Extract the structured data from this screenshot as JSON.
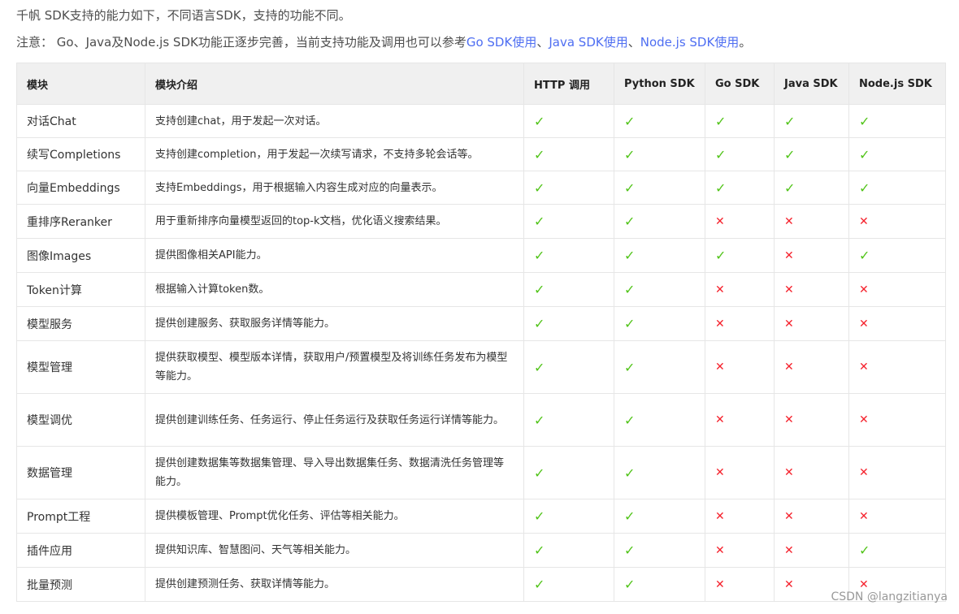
{
  "intro": "千帆 SDK支持的能力如下，不同语言SDK，支持的功能不同。",
  "note": {
    "prefix": "注意：  Go、Java及Node.js SDK功能正逐步完善，当前支持功能及调用也可以参考",
    "link1": "Go SDK使用",
    "sep1": "、",
    "link2": "Java SDK使用",
    "sep2": "、",
    "link3": "Node.js SDK使用",
    "suffix": "。"
  },
  "table": {
    "headers": [
      "模块",
      "模块介绍",
      "HTTP 调用",
      "Python SDK",
      "Go SDK",
      "Java SDK",
      "Node.js SDK"
    ],
    "rows": [
      {
        "name": "对话Chat",
        "desc": "支持创建chat，用于发起一次对话。",
        "support": [
          "✓",
          "✓",
          "✓",
          "✓",
          "✓"
        ]
      },
      {
        "name": "续写Completions",
        "desc": "支持创建completion，用于发起一次续写请求，不支持多轮会话等。",
        "support": [
          "✓",
          "✓",
          "✓",
          "✓",
          "✓"
        ]
      },
      {
        "name": "向量Embeddings",
        "desc": "支持Embeddings，用于根据输入内容生成对应的向量表示。",
        "support": [
          "✓",
          "✓",
          "✓",
          "✓",
          "✓"
        ]
      },
      {
        "name": "重排序Reranker",
        "desc": "用于重新排序向量模型返回的top-k文档，优化语义搜索结果。",
        "support": [
          "✓",
          "✓",
          "✕",
          "✕",
          "✕"
        ]
      },
      {
        "name": "图像Images",
        "desc": "提供图像相关API能力。",
        "support": [
          "✓",
          "✓",
          "✓",
          "✕",
          "✓"
        ]
      },
      {
        "name": "Token计算",
        "desc": "根据输入计算token数。",
        "support": [
          "✓",
          "✓",
          "✕",
          "✕",
          "✕"
        ]
      },
      {
        "name": "模型服务",
        "desc": "提供创建服务、获取服务详情等能力。",
        "support": [
          "✓",
          "✓",
          "✕",
          "✕",
          "✕"
        ]
      },
      {
        "name": "模型管理",
        "desc": "提供获取模型、模型版本详情，获取用户/预置模型及将训练任务发布为模型等能力。",
        "support": [
          "✓",
          "✓",
          "✕",
          "✕",
          "✕"
        ]
      },
      {
        "name": "模型调优",
        "desc": "提供创建训练任务、任务运行、停止任务运行及获取任务运行详情等能力。",
        "support": [
          "✓",
          "✓",
          "✕",
          "✕",
          "✕"
        ]
      },
      {
        "name": "数据管理",
        "desc": "提供创建数据集等数据集管理、导入导出数据集任务、数据清洗任务管理等能力。",
        "support": [
          "✓",
          "✓",
          "✕",
          "✕",
          "✕"
        ]
      },
      {
        "name": "Prompt工程",
        "desc": "提供模板管理、Prompt优化任务、评估等相关能力。",
        "support": [
          "✓",
          "✓",
          "✕",
          "✕",
          "✕"
        ]
      },
      {
        "name": "插件应用",
        "desc": "提供知识库、智慧图问、天气等相关能力。",
        "support": [
          "✓",
          "✓",
          "✕",
          "✕",
          "✓"
        ]
      },
      {
        "name": "批量预测",
        "desc": "提供创建预测任务、获取详情等能力。",
        "support": [
          "✓",
          "✓",
          "✕",
          "✕",
          "✕"
        ]
      }
    ]
  },
  "watermark": "CSDN @langzitianya",
  "colors": {
    "link": "#4e6ef2",
    "check": "#52c41a",
    "cross": "#f5222d",
    "header_bg": "#f0f0f0",
    "border": "#e6e6e6"
  }
}
